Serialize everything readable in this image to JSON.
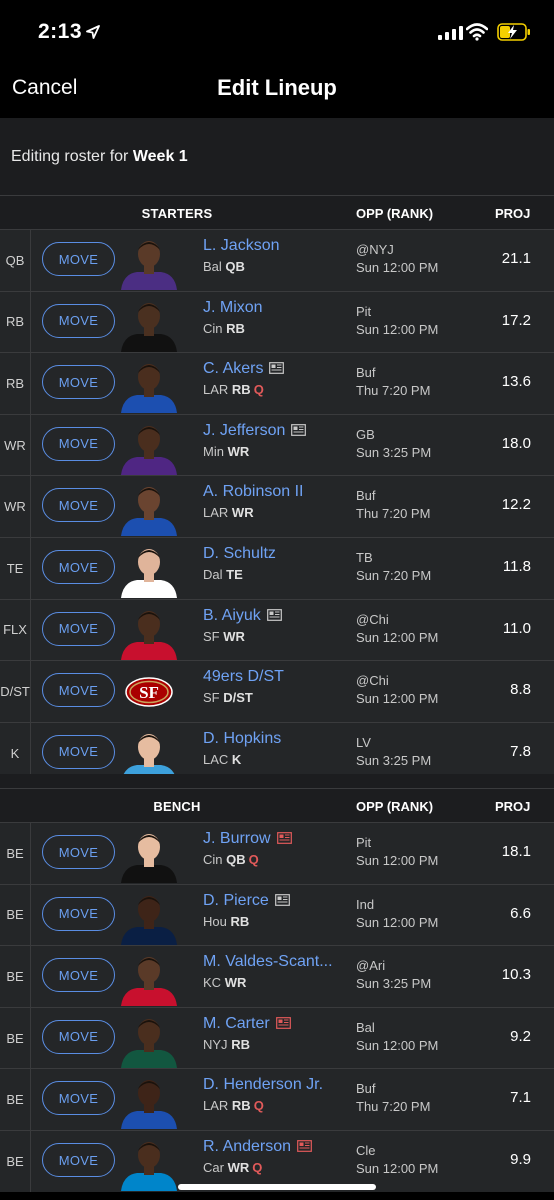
{
  "status": {
    "time": "2:13"
  },
  "nav": {
    "cancel": "Cancel",
    "title": "Edit Lineup"
  },
  "editing": {
    "prefix": "Editing roster for ",
    "week": "Week 1"
  },
  "starters_header": {
    "title": "STARTERS",
    "opp": "OPP (RANK)",
    "proj": "PROJ"
  },
  "bench_header": {
    "title": "BENCH",
    "opp": "OPP (RANK)",
    "proj": "PROJ"
  },
  "move_label": "MOVE",
  "starters": [
    {
      "slot": "QB",
      "name": "L. Jackson",
      "team": "Bal",
      "pos": "QB",
      "injury": "",
      "news": false,
      "opp": "@NYJ",
      "time": "Sun 12:00 PM",
      "proj": "21.1",
      "jersey": "#4b2e83",
      "skin": "#5a3a28"
    },
    {
      "slot": "RB",
      "name": "J. Mixon",
      "team": "Cin",
      "pos": "RB",
      "injury": "",
      "news": false,
      "opp": "Pit",
      "time": "Sun 12:00 PM",
      "proj": "17.2",
      "jersey": "#111111",
      "skin": "#4a3020"
    },
    {
      "slot": "RB",
      "name": "C. Akers",
      "team": "LAR",
      "pos": "RB",
      "injury": "Q",
      "news": true,
      "opp": "Buf",
      "time": "Thu 7:20 PM",
      "proj": "13.6",
      "jersey": "#1c4fb0",
      "skin": "#4a2e1e"
    },
    {
      "slot": "WR",
      "name": "J. Jefferson",
      "team": "Min",
      "pos": "WR",
      "injury": "",
      "news": true,
      "opp": "GB",
      "time": "Sun 3:25 PM",
      "proj": "18.0",
      "jersey": "#4f2683",
      "skin": "#4a2e1e"
    },
    {
      "slot": "WR",
      "name": "A. Robinson II",
      "team": "LAR",
      "pos": "WR",
      "injury": "",
      "news": false,
      "opp": "Buf",
      "time": "Thu 7:20 PM",
      "proj": "12.2",
      "jersey": "#1c4fb0",
      "skin": "#6a4430"
    },
    {
      "slot": "TE",
      "name": "D. Schultz",
      "team": "Dal",
      "pos": "TE",
      "injury": "",
      "news": false,
      "opp": "TB",
      "time": "Sun 7:20 PM",
      "proj": "11.8",
      "jersey": "#ffffff",
      "skin": "#e0b49a"
    },
    {
      "slot": "FLX",
      "name": "B. Aiyuk",
      "team": "SF",
      "pos": "WR",
      "injury": "",
      "news": true,
      "opp": "@Chi",
      "time": "Sun 12:00 PM",
      "proj": "11.0",
      "jersey": "#c8102e",
      "skin": "#4a2e1e"
    },
    {
      "slot": "D/\nST",
      "name": "49ers D/ST",
      "team": "SF",
      "pos": "D/ST",
      "injury": "",
      "news": false,
      "opp": "@Chi",
      "time": "Sun 12:00 PM",
      "proj": "8.8",
      "jersey": "",
      "skin": "",
      "logo": "SF"
    },
    {
      "slot": "K",
      "name": "D. Hopkins",
      "team": "LAC",
      "pos": "K",
      "injury": "",
      "news": false,
      "opp": "LV",
      "time": "Sun 3:25 PM",
      "proj": "7.8",
      "jersey": "#3da1dc",
      "skin": "#e6bca0"
    }
  ],
  "bench": [
    {
      "slot": "BE",
      "name": "J. Burrow",
      "team": "Cin",
      "pos": "QB",
      "injury": "Q",
      "news": true,
      "newsRed": true,
      "opp": "Pit",
      "time": "Sun 12:00 PM",
      "proj": "18.1",
      "jersey": "#111111",
      "skin": "#e6bca0"
    },
    {
      "slot": "BE",
      "name": "D. Pierce",
      "team": "Hou",
      "pos": "RB",
      "injury": "",
      "news": true,
      "opp": "Ind",
      "time": "Sun 12:00 PM",
      "proj": "6.6",
      "jersey": "#0a1f44",
      "skin": "#3e2418"
    },
    {
      "slot": "BE",
      "name": "M. Valdes-Scant...",
      "team": "KC",
      "pos": "WR",
      "injury": "",
      "news": false,
      "opp": "@Ari",
      "time": "Sun 3:25 PM",
      "proj": "10.3",
      "jersey": "#c8102e",
      "skin": "#5a3a28"
    },
    {
      "slot": "BE",
      "name": "M. Carter",
      "team": "NYJ",
      "pos": "RB",
      "injury": "",
      "news": true,
      "newsRed": true,
      "opp": "Bal",
      "time": "Sun 12:00 PM",
      "proj": "9.2",
      "jersey": "#125740",
      "skin": "#4a2e1e"
    },
    {
      "slot": "BE",
      "name": "D. Henderson Jr.",
      "team": "LAR",
      "pos": "RB",
      "injury": "Q",
      "news": false,
      "opp": "Buf",
      "time": "Thu 7:20 PM",
      "proj": "7.1",
      "jersey": "#1c4fb0",
      "skin": "#3e2418"
    },
    {
      "slot": "BE",
      "name": "R. Anderson",
      "team": "Car",
      "pos": "WR",
      "injury": "Q",
      "news": true,
      "newsRed": true,
      "opp": "Cle",
      "time": "Sun 12:00 PM",
      "proj": "9.9",
      "jersey": "#0085ca",
      "skin": "#4a2e1e"
    }
  ]
}
